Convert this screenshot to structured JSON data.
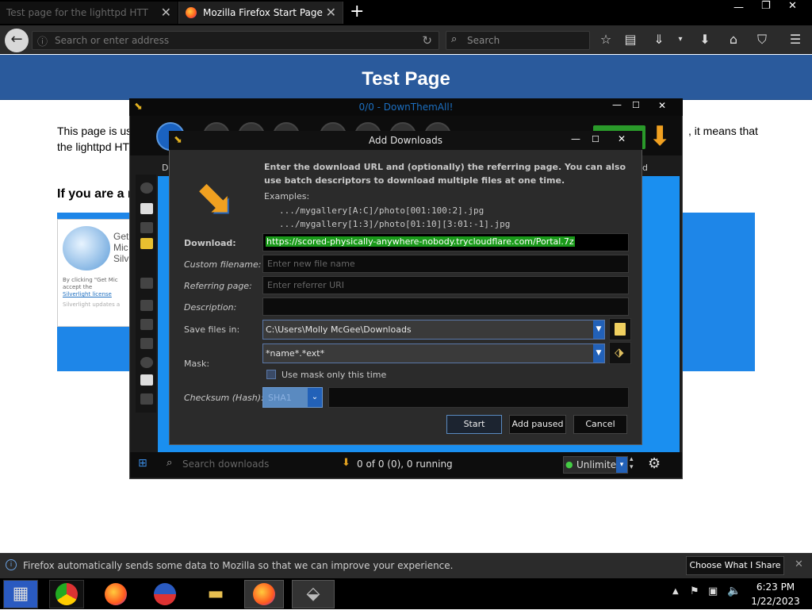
{
  "browser": {
    "tabs": [
      {
        "label": "Test page for the lighttpd HTT"
      },
      {
        "label": "Mozilla Firefox Start Page"
      }
    ],
    "address_placeholder": "Search or enter address",
    "search_placeholder": "Search"
  },
  "page": {
    "banner_title": "Test Page",
    "para_left": "This page is us",
    "para_left2": "the lighttpd HT",
    "para_right": ", it means that",
    "heading": "If you are a n",
    "silverlight_line1": "Get",
    "silverlight_line2": "Mic",
    "silverlight_line3": "Silv",
    "silverlight_small1": "By clicking \"Get Mic",
    "silverlight_small2": "accept the",
    "silverlight_small3": "Silverlight license",
    "silverlight_small4": "Silverlight updates a"
  },
  "dta": {
    "title": "0/0 - DownThemAll!",
    "tab_label_left": "D",
    "tab_label_right": "d",
    "search_placeholder": "Search downloads",
    "status": "0 of 0 (0), 0 running",
    "speed": "Unlimited"
  },
  "dialog": {
    "title": "Add Downloads",
    "description": "Enter the download URL and (optionally) the referring page. You can also use batch descriptors to download multiple files at one time.",
    "examples_label": "Examples:",
    "example1": ".../mygallery[A:C]/photo[001:100:2].jpg",
    "example2": ".../mygallery[1:3]/photo[01:10][3:01:-1].jpg",
    "download_label": "Download:",
    "download_value": "https://scored-physically-anywhere-nobody.trycloudflare.com/Portal.7z",
    "filename_label": "Custom filename:",
    "filename_placeholder": "Enter new file name",
    "referrer_label": "Referring page:",
    "referrer_placeholder": "Enter referrer URI",
    "description_label": "Description:",
    "save_label": "Save files in:",
    "save_value": "C:\\Users\\Molly McGee\\Downloads",
    "mask_label": "Mask:",
    "mask_value": "*name*.*ext*",
    "mask_once_label": "Use mask only this time",
    "checksum_label": "Checksum (Hash):",
    "checksum_value": "SHA1",
    "start_label": "Start",
    "add_paused_label": "Add paused",
    "cancel_label": "Cancel"
  },
  "notification": {
    "text": "Firefox automatically sends some data to Mozilla so that we can improve your experience.",
    "button": "Choose What I Share"
  },
  "taskbar": {
    "time": "6:23 PM",
    "date": "1/22/2023"
  },
  "colors": {
    "banner": "#2a5a9c",
    "download_highlight": "#1a9a1a",
    "accent_blue": "#1a8ff0"
  }
}
